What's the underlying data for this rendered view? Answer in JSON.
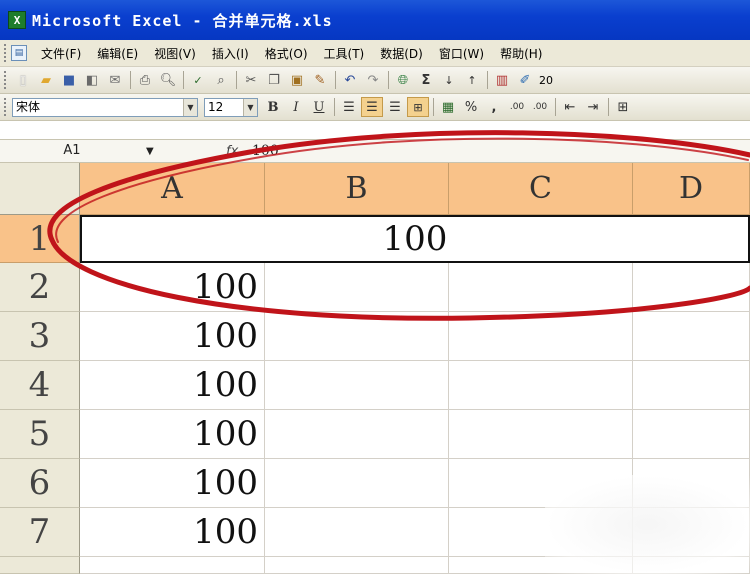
{
  "window": {
    "app_icon": "excel-icon",
    "title": "Microsoft Excel - 合并单元格.xls"
  },
  "menubar": {
    "doc_icon": "document-icon",
    "items": [
      {
        "label": "文件(F)"
      },
      {
        "label": "编辑(E)"
      },
      {
        "label": "视图(V)"
      },
      {
        "label": "插入(I)"
      },
      {
        "label": "格式(O)"
      },
      {
        "label": "工具(T)"
      },
      {
        "label": "数据(D)"
      },
      {
        "label": "窗口(W)"
      },
      {
        "label": "帮助(H)"
      }
    ]
  },
  "standard_toolbar": {
    "icons": [
      "new-icon",
      "open-icon",
      "save-icon",
      "permission-icon",
      "email-icon",
      "print-icon",
      "print-preview-icon",
      "spelling-icon",
      "research-icon",
      "cut-icon",
      "copy-icon",
      "paste-icon",
      "format-painter-icon",
      "undo-icon",
      "redo-icon",
      "hyperlink-icon",
      "autosum-icon",
      "sort-ascending-icon",
      "sort-descending-icon",
      "chart-wizard-icon",
      "drawing-icon"
    ],
    "zoom_partial": "20"
  },
  "format_toolbar": {
    "font_name": "宋体",
    "font_size": "12",
    "bold": "B",
    "italic": "I",
    "underline": "U",
    "percent": "%",
    "comma": ",",
    "increase_decimal": ".00",
    "decrease_decimal": ".00"
  },
  "formula_bar": {
    "name_box": "A1",
    "fx": "fx",
    "value": "100"
  },
  "sheet": {
    "columns": [
      "A",
      "B",
      "C",
      "D"
    ],
    "rows": [
      "1",
      "2",
      "3",
      "4",
      "5",
      "6",
      "7"
    ],
    "merged_cell_value": "100",
    "column_a_values": [
      "100",
      "100",
      "100",
      "100",
      "100",
      "100"
    ]
  },
  "colors": {
    "title_bar": "#0a3fcf",
    "header_highlight": "#f9c289",
    "annotation_ellipse": "#c0141a"
  }
}
